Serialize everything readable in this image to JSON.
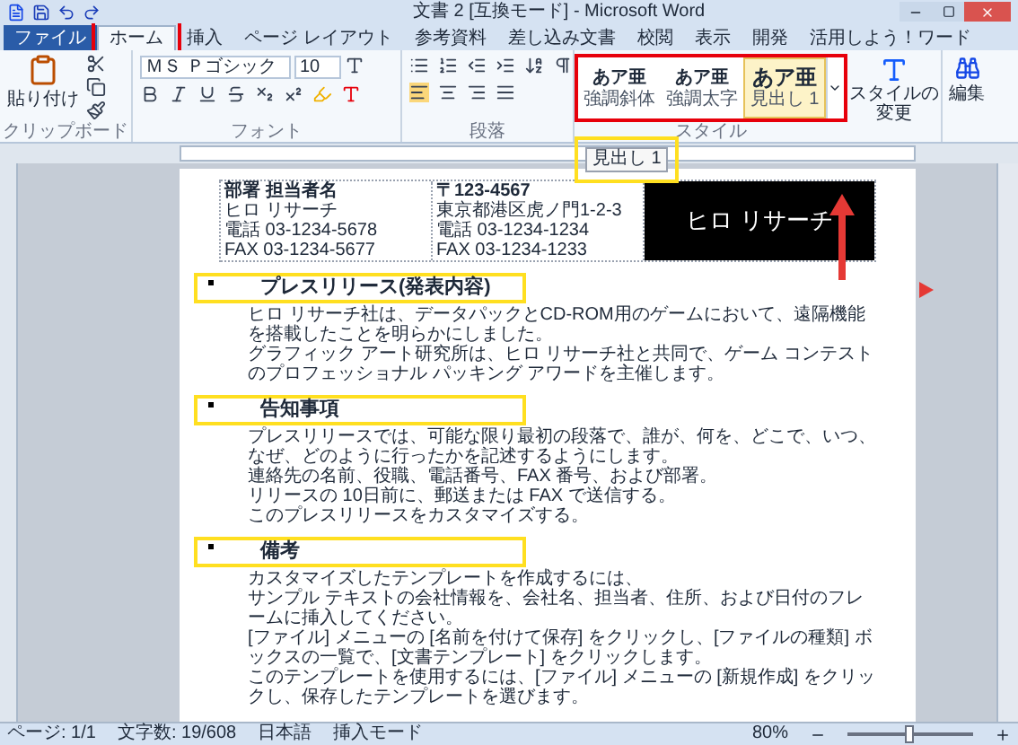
{
  "window": {
    "title": "文書 2 [互換モード] - Microsoft Word"
  },
  "tabs": [
    {
      "label": "ファイル",
      "kind": "file",
      "selected": false
    },
    {
      "label": "ホーム",
      "kind": "tab",
      "selected": true
    },
    {
      "label": "挿入",
      "kind": "tab",
      "selected": false
    },
    {
      "label": "ページ レイアウト",
      "kind": "tab",
      "selected": false
    },
    {
      "label": "参考資料",
      "kind": "tab",
      "selected": false
    },
    {
      "label": "差し込み文書",
      "kind": "tab",
      "selected": false
    },
    {
      "label": "校閲",
      "kind": "tab",
      "selected": false
    },
    {
      "label": "表示",
      "kind": "tab",
      "selected": false
    },
    {
      "label": "開発",
      "kind": "tab",
      "selected": false
    },
    {
      "label": "活用しよう！ワード",
      "kind": "tab",
      "selected": false
    }
  ],
  "ribbon": {
    "clipboard": {
      "paste": "貼り付け",
      "label": "クリップボード"
    },
    "font": {
      "name": "ＭＳ Ｐゴシック",
      "size": "10",
      "label": "フォント"
    },
    "paragraph": {
      "label": "段落"
    },
    "styles": {
      "items": [
        {
          "sample": "あア亜",
          "label": "強調斜体",
          "selected": false
        },
        {
          "sample": "あア亜",
          "label": "強調太字",
          "selected": false
        },
        {
          "sample": "あア亜",
          "label": "見出し 1",
          "selected": true
        }
      ],
      "label": "スタイル",
      "change": "スタイルの変更",
      "edit": "編集"
    }
  },
  "tooltip": "見出し 1",
  "document": {
    "header": {
      "left": [
        "部署 担当者名",
        "ヒロ リサーチ",
        "電話 03-1234-5678",
        "FAX 03-1234-5677"
      ],
      "middle": [
        "〒123-4567",
        "東京都港区虎ノ門1-2-3",
        "電話 03-1234-1234",
        "FAX 03-1234-1233"
      ],
      "logo": "ヒロ リサーチ"
    },
    "sections": [
      {
        "heading": "プレスリリース(発表内容)",
        "paragraphs": [
          "ヒロ リサーチ社は、データパックとCD-ROM用のゲームにおいて、遠隔機能を搭載したことを明らかにしました。",
          "グラフィック アート研究所は、ヒロ リサーチ社と共同で、ゲーム コンテストのプロフェッショナル パッキング アワードを主催します。"
        ]
      },
      {
        "heading": "告知事項",
        "paragraphs": [
          "プレスリリースでは、可能な限り最初の段落で、誰が、何を、どこで、いつ、なぜ、どのように行ったかを記述するようにします。",
          "連絡先の名前、役職、電話番号、FAX 番号、および部署。",
          "リリースの 10日前に、郵送または FAX で送信する。",
          "このプレスリリースをカスタマイズする。"
        ]
      },
      {
        "heading": "備考",
        "paragraphs": [
          "カスタマイズしたテンプレートを作成するには、",
          "サンプル テキストの会社情報を、会社名、担当者、住所、および日付のフレームに挿入してください。",
          "[ファイル] メニューの [名前を付けて保存] をクリックし、[ファイルの種類] ボックスの一覧で、[文書テンプレート] をクリックします。",
          "このテンプレートを使用するには、[ファイル] メニューの [新規作成] をクリックし、保存したテンプレートを選びます。"
        ]
      }
    ]
  },
  "status_bar": {
    "page": "ページ: 1/1",
    "words": "文字数: 19/608",
    "language": "日本語",
    "mode": "挿入モード",
    "zoom": "80%",
    "zoom_slider": {
      "level": 0.5
    }
  }
}
